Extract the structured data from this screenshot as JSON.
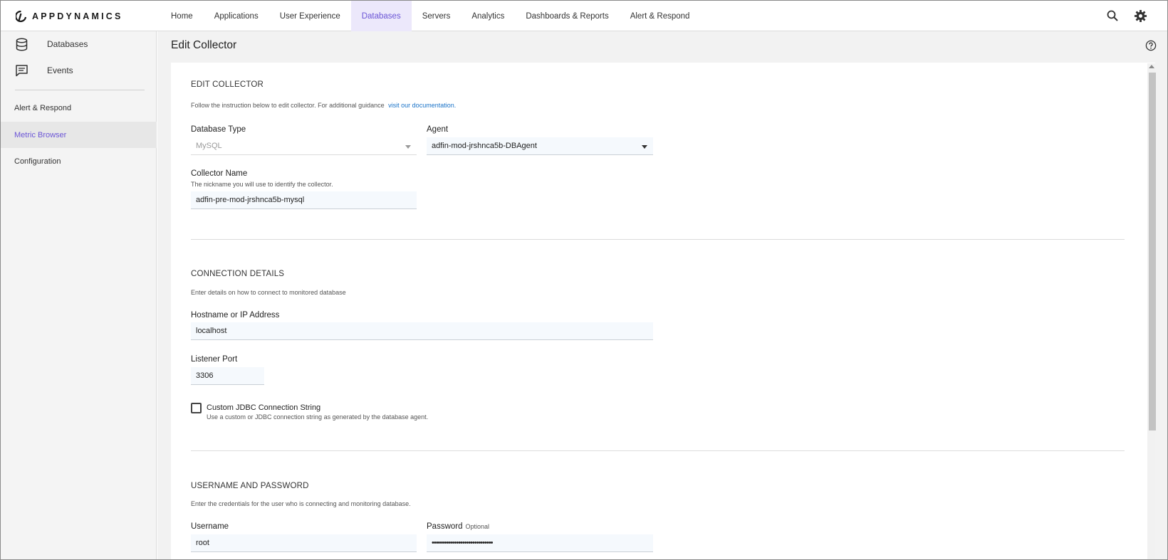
{
  "brand": {
    "name": "APPDYNAMICS"
  },
  "nav": {
    "items": [
      {
        "label": "Home",
        "active": false
      },
      {
        "label": "Applications",
        "active": false
      },
      {
        "label": "User Experience",
        "active": false
      },
      {
        "label": "Databases",
        "active": true
      },
      {
        "label": "Servers",
        "active": false
      },
      {
        "label": "Analytics",
        "active": false
      },
      {
        "label": "Dashboards & Reports",
        "active": false
      },
      {
        "label": "Alert & Respond",
        "active": false
      }
    ],
    "icons": [
      "search-icon",
      "gear-icon"
    ]
  },
  "sidebar": {
    "top_items": [
      {
        "label": "Databases",
        "icon": "database-icon"
      },
      {
        "label": "Events",
        "icon": "chat-icon"
      }
    ],
    "items": [
      {
        "label": "Alert & Respond",
        "active": false
      },
      {
        "label": "Metric Browser",
        "active": true
      },
      {
        "label": "Configuration",
        "active": false
      }
    ]
  },
  "page": {
    "title": "Edit Collector",
    "help_icon": "help-circle-icon"
  },
  "edit_collector": {
    "title": "EDIT COLLECTOR",
    "help": "Follow the instruction below to edit collector. For additional guidance",
    "link": "visit our documentation.",
    "db_type_label": "Database Type",
    "db_type_value": "MySQL",
    "agent_label": "Agent",
    "agent_value": "adfin-mod-jrshnca5b-DBAgent",
    "name_label": "Collector Name",
    "name_sub": "The nickname you will use to identify the collector.",
    "name_value": "adfin-pre-mod-jrshnca5b-mysql"
  },
  "connection": {
    "title": "CONNECTION DETAILS",
    "help": "Enter details on how to connect to monitored database",
    "host_label": "Hostname or IP Address",
    "host_value": "localhost",
    "port_label": "Listener Port",
    "port_value": "3306",
    "jdbc_label": "Custom JDBC Connection String",
    "jdbc_sub": "Use a custom or JDBC connection string as generated by the database agent.",
    "jdbc_checked": false
  },
  "credentials": {
    "title": "USERNAME AND PASSWORD",
    "help": "Enter the credentials for the user who is connecting and monitoring database.",
    "username_label": "Username",
    "username_value": "root",
    "password_label": "Password",
    "password_optional": "Optional",
    "password_value": "••••••••••••••••••••••••••••••"
  },
  "colors": {
    "accent": "#6b55d6",
    "link": "#1a73c8"
  }
}
